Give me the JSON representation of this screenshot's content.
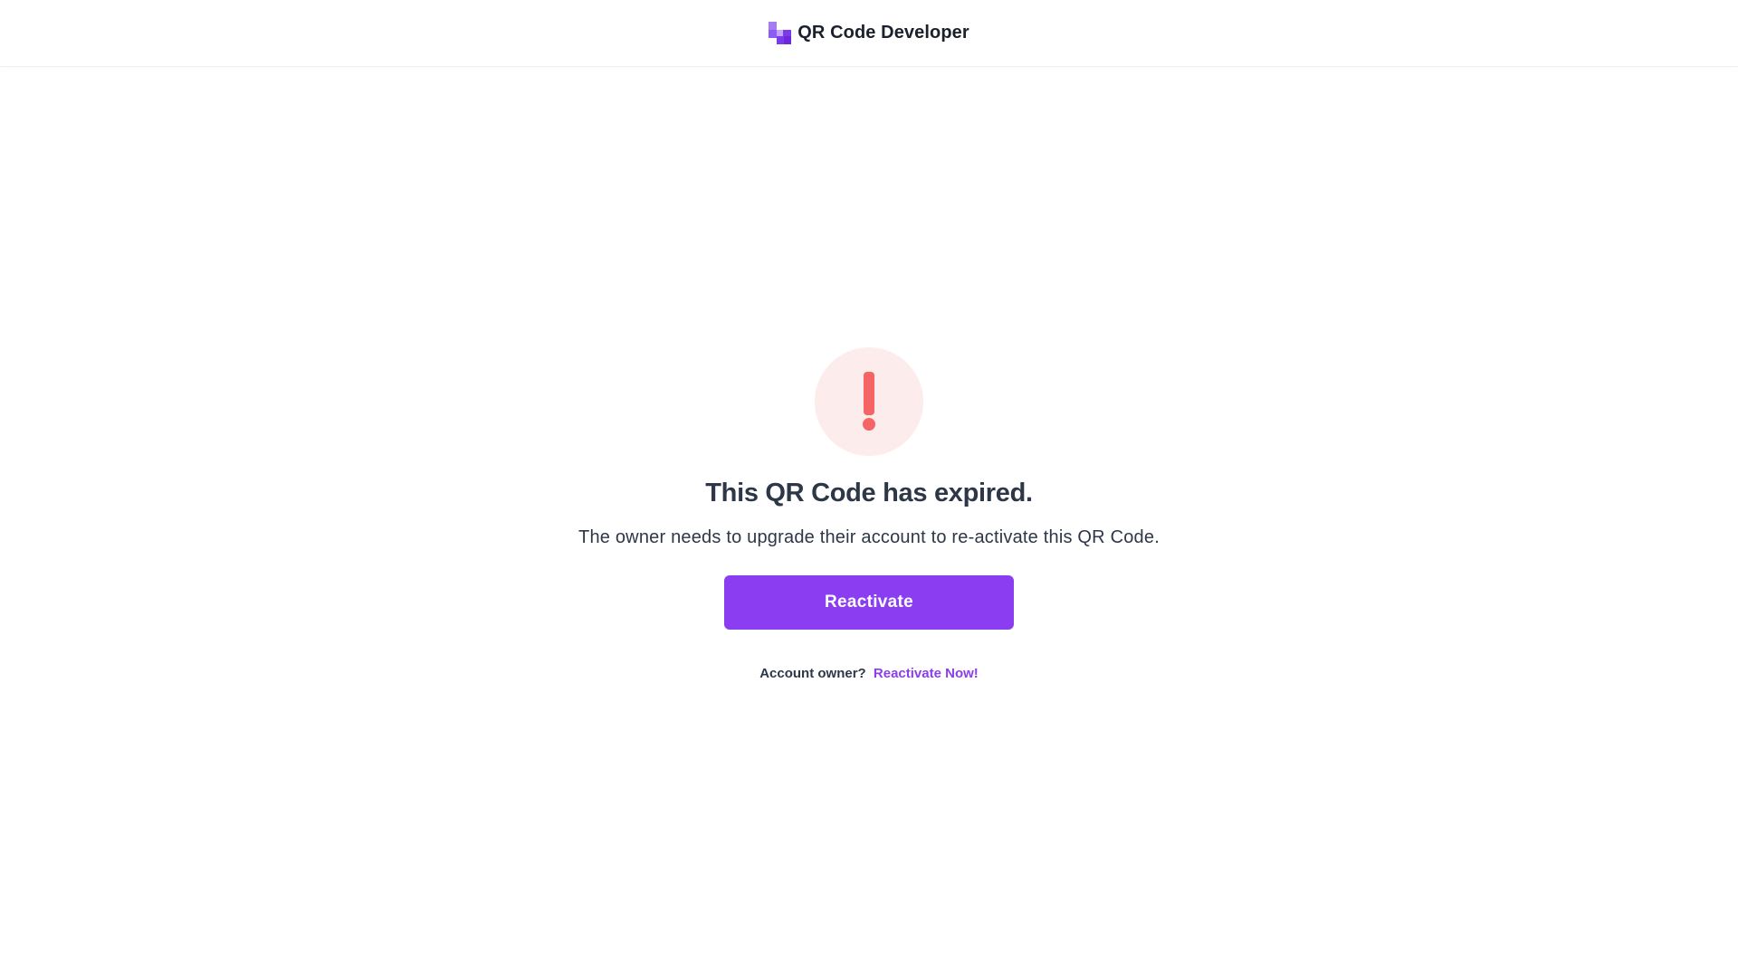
{
  "header": {
    "brand_name": "QR Code Developer",
    "logo_icon": "qr-blocks-logo-icon",
    "brand_color": "#7c3aed"
  },
  "main": {
    "alert_icon": "exclamation-icon",
    "alert_color": "#f56565",
    "alert_bg": "#fdecec",
    "title": "This QR Code has expired.",
    "description": "The owner needs to upgrade their account to re-activate this QR Code.",
    "button_label": "Reactivate",
    "owner_prompt": "Account owner?",
    "owner_link": "Reactivate Now!",
    "accent_color": "#8b3df1"
  }
}
